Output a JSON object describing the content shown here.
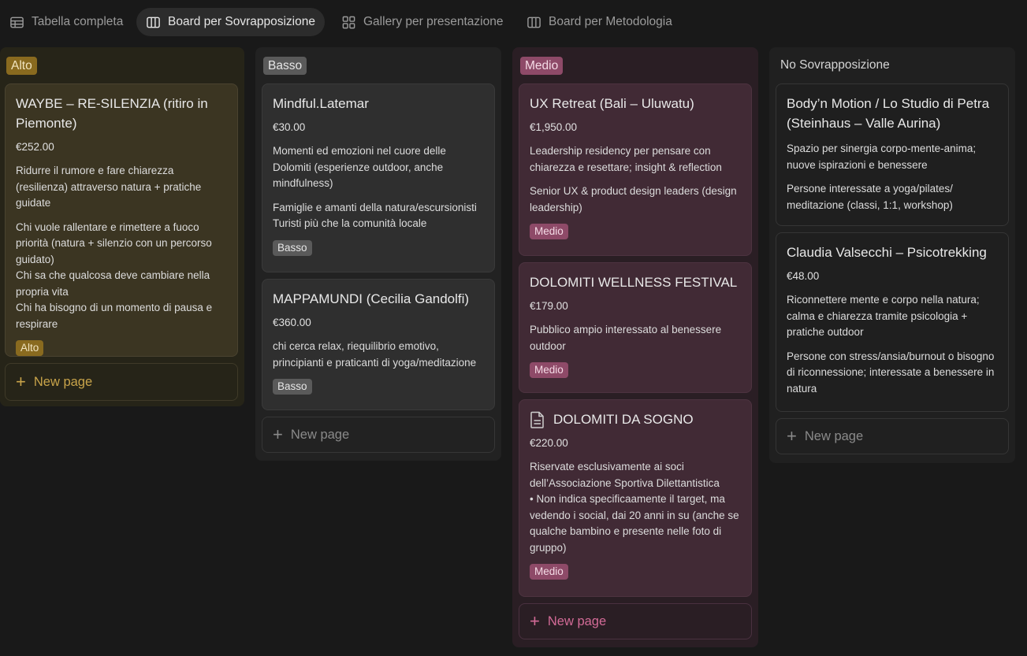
{
  "tabs": [
    {
      "label": "Tabella completa",
      "icon": "table-icon"
    },
    {
      "label": "Board per Sovrapposizione",
      "icon": "board-icon",
      "active": true
    },
    {
      "label": "Gallery per presentazione",
      "icon": "gallery-icon"
    },
    {
      "label": "Board per Metodologia",
      "icon": "board-icon"
    }
  ],
  "new_page_label": "New page",
  "columns": {
    "alto": {
      "label": "Alto",
      "cards": [
        {
          "title": "WAYBE – RE-SILENZIA (ritiro in Piemonte)",
          "price": "€252.00",
          "p1": "Ridurre il rumore e fare chiarezza (resilienza) attraverso natura + pratiche guidate",
          "p2": "Chi vuole rallentare e rimettere a fuoco priorità (natura + silenzio con un percorso guidato)\nChi sa che qualcosa deve cambiare nella propria vita\nChi ha bisogno di un momento di pausa e respirare",
          "badge": "Alto"
        }
      ]
    },
    "basso": {
      "label": "Basso",
      "cards": [
        {
          "title": "Mindful.Latemar",
          "price": "€30.00",
          "p1": "Momenti ed emozioni nel cuore delle Dolomiti (esperienze outdoor, anche mindfulness)",
          "p2": "Famiglie e amanti della natura/escursionisti\nTuristi più che la comunità locale",
          "badge": "Basso"
        },
        {
          "title": "MAPPAMUNDI (Cecilia Gandolfi)",
          "price": "€360.00",
          "p1": "chi cerca relax, riequilibrio emotivo, principianti e praticanti di yoga/meditazione",
          "badge": "Basso"
        }
      ]
    },
    "medio": {
      "label": "Medio",
      "cards": [
        {
          "title": "UX Retreat (Bali – Uluwatu)",
          "price": "€1,950.00",
          "p1": "Leadership residency per pensare con chiarezza e resettare; insight & reflection",
          "p2": "Senior UX & product design leaders (design leadership)",
          "badge": "Medio"
        },
        {
          "title": "DOLOMITI WELLNESS FESTIVAL",
          "price": "€179.00",
          "p1": "Pubblico ampio interessato al benessere outdoor",
          "badge": "Medio"
        },
        {
          "title": "DOLOMITI DA SOGNO",
          "price": "€220.00",
          "p1": "Riservate esclusivamente ai soci dell’Associazione Sportiva Dilettantistica\n  • Non indica specificaamente il target, ma vedendo i social, dai 20 anni in su (anche se qualche bambino e presente nelle foto di gruppo)",
          "badge": "Medio"
        }
      ]
    },
    "none": {
      "label": "No Sovrapposizione",
      "cards": [
        {
          "title": "Body’n Motion / Lo Studio di Petra (Steinhaus – Valle Aurina)",
          "p1": "Spazio per sinergia corpo-mente-anima; nuove ispirazioni e benessere",
          "p2": "Persone interessate a yoga/pilates/ meditazione (classi, 1:1, workshop)"
        },
        {
          "title": "Claudia Valsecchi – Psicotrekking",
          "price": "€48.00",
          "p1": "Riconnettere mente e corpo nella natura; calma e chiarezza tramite psicologia + pratiche outdoor",
          "p2": "Persone con stress/ansia/burnout o bisogno di riconnessione; interessate a benessere in natura"
        }
      ]
    }
  }
}
